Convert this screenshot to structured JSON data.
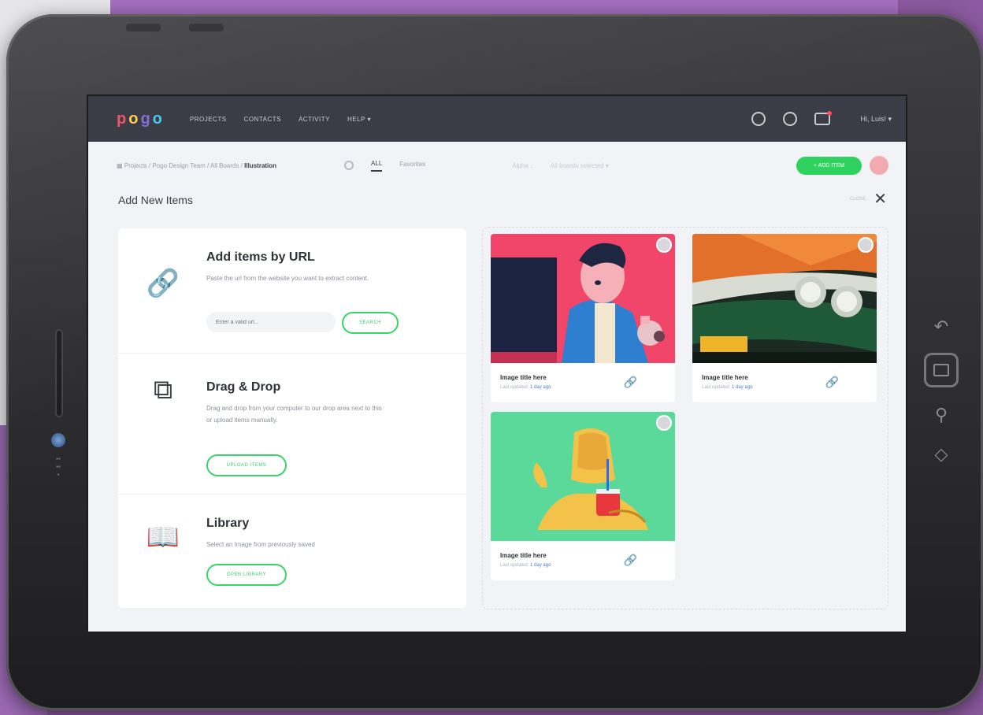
{
  "app": {
    "logo": "pogo",
    "nav": [
      "PROJECTS",
      "CONTACTS",
      "ACTIVITY",
      "HELP ▾"
    ],
    "user": "Hi, Luis! ▾"
  },
  "breadcrumb": {
    "path": "▦  Projects / Pogo Design Team / All Boards / ",
    "current": "Illustration"
  },
  "tabs": [
    "ALL",
    "Favorites"
  ],
  "toolbar": {
    "filters": [
      "Alpha ↓",
      "All boards selected ▾"
    ],
    "add_button": "+ ADD ITEM"
  },
  "panel": {
    "title": "Add New Items",
    "close_label": "CLOSE"
  },
  "options": [
    {
      "title": "Add items by URL",
      "desc": "Paste the url from the website you want to extract content.",
      "input_placeholder": "Enter a valid url...",
      "button": "SEARCH"
    },
    {
      "title": "Drag & Drop",
      "desc": "Drag and drop from your computer to our drop area next to this or upload items manually.",
      "button": "UPLOAD ITEMS"
    },
    {
      "title": "Library",
      "desc": "Select an Image from previously saved",
      "button": "OPEN LIBRARY"
    }
  ],
  "cards": [
    {
      "title": "Image title here",
      "updated_prefix": "Last updated:",
      "updated_value": "1 day ago",
      "bg": "#f2456a"
    },
    {
      "title": "Image title here",
      "updated_prefix": "Last updated:",
      "updated_value": "1 day ago",
      "bg": "#1d2a24"
    },
    {
      "title": "Image title here",
      "updated_prefix": "Last updated:",
      "updated_value": "1 day ago",
      "bg": "#5bd99a"
    }
  ],
  "colors": {
    "accent_green": "#2fd25e",
    "topbar": "#3a3d45",
    "link_blue": "#4b7bd9"
  }
}
